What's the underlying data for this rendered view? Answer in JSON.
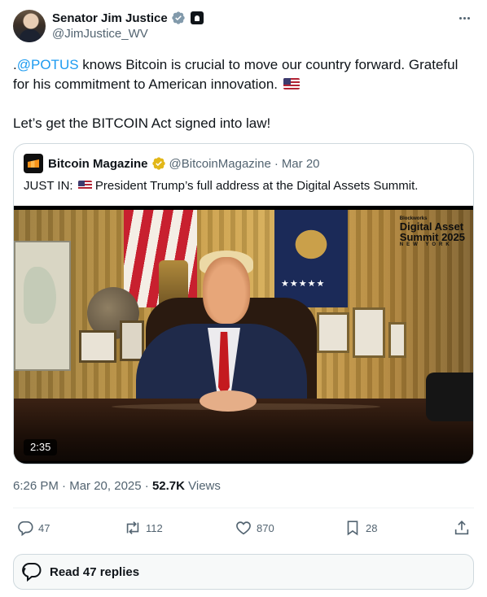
{
  "author": {
    "display_name": "Senator Jim Justice",
    "handle": "@JimJustice_WV"
  },
  "tweet": {
    "mention": "@POTUS",
    "line1_prefix": ".",
    "line1_rest": " knows Bitcoin is crucial to move our country forward. Grateful for his commitment to American innovation. ",
    "line2": "Let’s get the BITCOIN Act signed into law!"
  },
  "quoted": {
    "name": "Bitcoin Magazine",
    "handle": "@BitcoinMagazine",
    "date": "Mar 20",
    "separator": "·",
    "text_prefix": "JUST IN: ",
    "text_rest": " President Trump’s full address at the Digital Assets Summit.",
    "video": {
      "duration": "2:35",
      "watermark_top": "Blockworks",
      "watermark_title_1": "Digital Asset",
      "watermark_title_2": "Summit 2025",
      "watermark_sub": "NEW YORK"
    }
  },
  "meta": {
    "time": "6:26 PM",
    "separator": " · ",
    "date": "Mar 20, 2025",
    "views_count": "52.7K",
    "views_label": " Views"
  },
  "actions": {
    "replies": "47",
    "reposts": "112",
    "likes": "870",
    "bookmarks": "28"
  },
  "read_replies_label": "Read 47 replies",
  "colors": {
    "link": "#1d9bf0",
    "secondary_text": "#536471",
    "verified_blue": "#1d9bf0",
    "verified_gold": "#e2b719"
  },
  "icons": [
    "verified-badge-icon",
    "government-badge-icon",
    "more-options-icon",
    "reply-icon",
    "repost-icon",
    "like-icon",
    "bookmark-icon",
    "share-icon",
    "replies-bubble-icon",
    "us-flag-emoji"
  ]
}
